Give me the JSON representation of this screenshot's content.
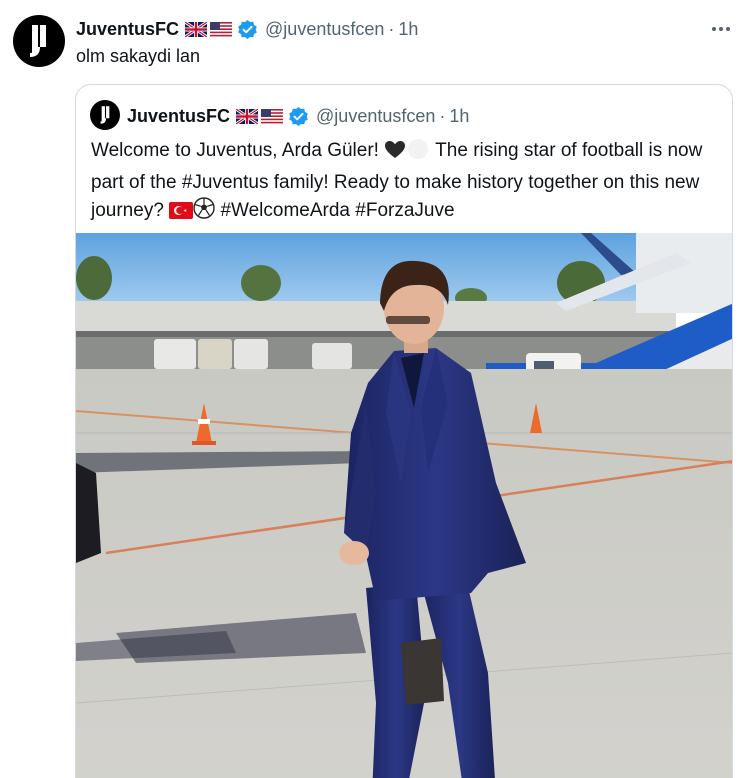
{
  "tweet": {
    "author": {
      "name": "JuventusFC",
      "handle": "@juventusfcen",
      "time": "1h",
      "separator": "·"
    },
    "text": "olm sakaydi lan"
  },
  "quote": {
    "author": {
      "name": "JuventusFC",
      "handle": "@juventusfcen",
      "time": "1h",
      "separator": "·"
    },
    "text_part1": "Welcome to Juventus, Arda Güler! ",
    "text_part2": " The rising star of football is now part of the #Juventus family! Ready to make history together on this new journey? ",
    "text_part3": " #WelcomeArda #ForzaJuve",
    "image_alt": "Player in navy double-breasted suit walking on airport tarmac"
  },
  "icons": {
    "avatar": "juventus-logo-icon",
    "flags": [
      "uk-flag-icon",
      "us-flag-icon"
    ],
    "verified": "verified-badge-icon",
    "more": "more-icon",
    "emoji": [
      "black-heart-icon",
      "white-heart-icon",
      "turkey-flag-icon",
      "soccer-ball-icon"
    ]
  },
  "colors": {
    "text": "#0f1419",
    "muted": "#536471",
    "verified": "#1d9bf0",
    "border": "#cfd9de"
  }
}
